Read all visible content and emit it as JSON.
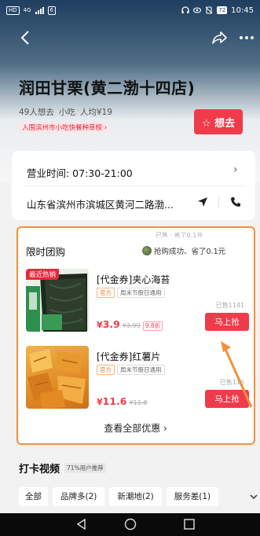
{
  "status_bar": {
    "left_tag": "HD",
    "signal_label": "4G",
    "notification_count": "6",
    "battery_label": "72",
    "time": "10:45"
  },
  "shop": {
    "name": "润田甘栗(黄二渤十四店)",
    "want_count": "49人想去",
    "category": "小吃",
    "avg_price": "人均¥19",
    "ranking": "入围滨州市小吃快餐种草榜 ›",
    "want_button": "☆ 想去"
  },
  "info": {
    "hours": "营业时间: 07:30-21:00",
    "address": "山东省滨州市滨城区黄河二路渤..."
  },
  "deals": {
    "header": "限时团购",
    "ticker_top": "已售 · 省了0.1元",
    "ticker": "抢购成功、省了0.1元",
    "items": [
      {
        "badge": "最近热销",
        "name": "[代金券]夹心海苔",
        "tag1": "官方",
        "tag2": "周末节假日通用",
        "sold": "已售1141",
        "price_symbol": "¥",
        "price": "3.9",
        "original": "¥3.99",
        "discount": "9.8折",
        "button": "马上抢"
      },
      {
        "badge": "",
        "name": "[代金券]红薯片",
        "tag1": "官方",
        "tag2": "周末节假日通用",
        "sold": "已售116",
        "price_symbol": "¥",
        "price": "11.6",
        "original": "¥11.8",
        "discount": "",
        "button": "马上抢"
      }
    ],
    "view_all": "查看全部优惠 ›"
  },
  "videos": {
    "title": "打卡视频",
    "badge": "71%用户推荐",
    "filters": [
      "全部",
      "品牌多(2)",
      "新潮地(2)",
      "服务差(1)"
    ]
  },
  "colors": {
    "accent_red": "#f03b4b",
    "highlight_orange": "#f4913c"
  }
}
